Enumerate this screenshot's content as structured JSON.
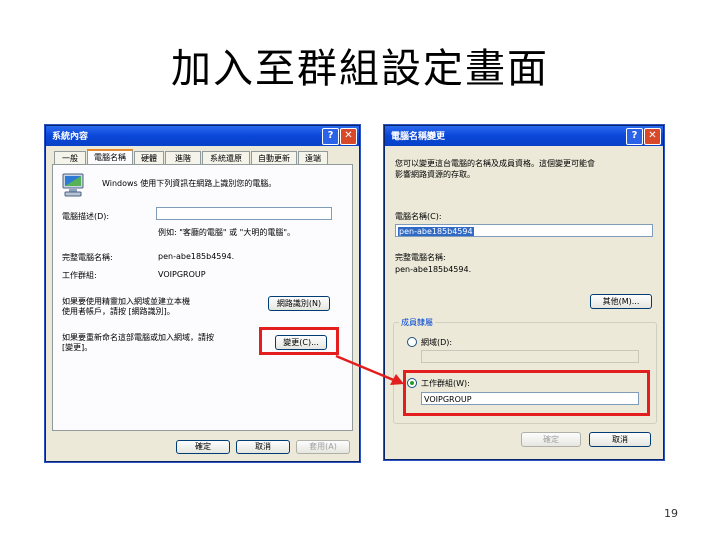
{
  "slide": {
    "title": "加入至群組設定畫面",
    "page_number": "19"
  },
  "left_window": {
    "title": "系統內容",
    "help_glyph": "?",
    "close_glyph": "✕",
    "tabs": [
      {
        "label": "一般"
      },
      {
        "label": "電腦名稱"
      },
      {
        "label": "硬體"
      },
      {
        "label": "進階"
      },
      {
        "label": "系統還原"
      },
      {
        "label": "自動更新"
      },
      {
        "label": "遠端"
      }
    ],
    "intro_text": "Windows 使用下列資訊在網路上識別您的電腦。",
    "description_label": "電腦描述(D):",
    "description_value": "",
    "example_text": "例如: \"客廳的電腦\" 或 \"大明的電腦\"。",
    "full_name_label": "完整電腦名稱:",
    "full_name_value": "pen-abe185b4594.",
    "workgroup_label": "工作群組:",
    "workgroup_value": "VOIPGROUP",
    "network_id_text_1": "如果要使用精靈加入網域並建立本機",
    "network_id_text_2": "使用者帳戶，請按 [網路識別]。",
    "network_id_button": "網路識別(N)",
    "rename_text_1": "如果要重新命名這部電腦或加入網域，請按",
    "rename_text_2": "[變更]。",
    "change_button": "變更(C)...",
    "ok_button": "確定",
    "cancel_button": "取消",
    "apply_button": "套用(A)"
  },
  "right_window": {
    "title": "電腦名稱變更",
    "help_glyph": "?",
    "close_glyph": "✕",
    "intro_text_1": "您可以變更這台電腦的名稱及成員資格。這個變更可能會",
    "intro_text_2": "影響網路資源的存取。",
    "computer_name_label": "電腦名稱(C):",
    "computer_name_value": "pen-abe185b4594",
    "full_name_label": "完整電腦名稱:",
    "full_name_value": "pen-abe185b4594.",
    "more_button": "其他(M)...",
    "member_group_label": "成員隸屬",
    "domain_label": "網域(D):",
    "domain_value": "",
    "workgroup_label": "工作群組(W):",
    "workgroup_value": "VOIPGROUP",
    "ok_button": "確定",
    "cancel_button": "取消"
  },
  "colors": {
    "highlight_red": "#e31e1e",
    "titlebar_blue": "#0a46d8",
    "dialog_bg": "#ece9d8"
  },
  "icons": {
    "computer": "computer-icon",
    "arrow": "arrow-icon"
  }
}
